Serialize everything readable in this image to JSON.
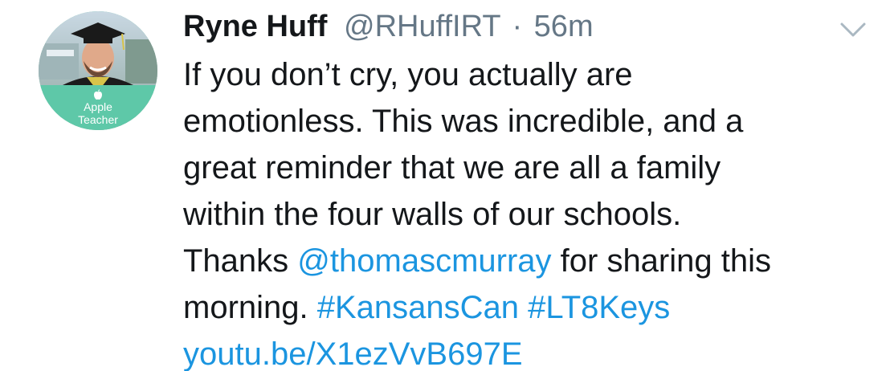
{
  "author": {
    "display_name": "Ryne Huff",
    "handle": "@RHuffIRT",
    "separator": "·",
    "timestamp": "56m",
    "avatar_badge": {
      "line1": "Apple",
      "line2": "Teacher",
      "icon": "apple-logo-icon"
    }
  },
  "tweet": {
    "line1": "If you don’t cry, you actually are",
    "line2": "emotionless. This was incredible, and a",
    "line3": "great reminder that we are all a family",
    "line4": "within the four walls of our schools.",
    "line5_prefix": "Thanks ",
    "mention": "@thomascmurray",
    "line5_suffix": " for sharing this",
    "line6_prefix": "morning. ",
    "hashtag1": "#KansansCan",
    "hashtag_space": " ",
    "hashtag2": "#LT8Keys",
    "url": "youtu.be/X1ezVvB697E"
  },
  "menu": {
    "icon": "chevron-down-icon"
  },
  "colors": {
    "text": "#14171a",
    "secondary": "#657786",
    "link": "#1b95e0",
    "badge": "#5ec8a8"
  }
}
